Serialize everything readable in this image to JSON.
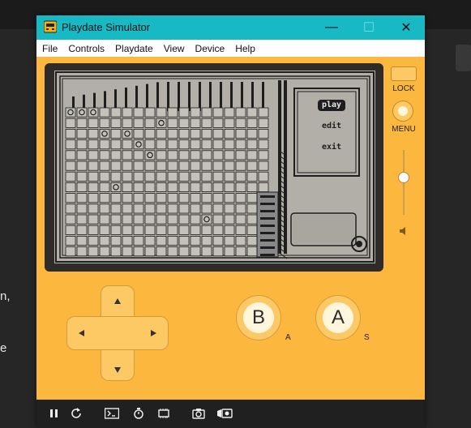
{
  "window": {
    "title": "Playdate Simulator",
    "controls": {
      "minimize": "—",
      "maximize": "☐",
      "close": "✕"
    }
  },
  "menubar": [
    "File",
    "Controls",
    "Playdate",
    "View",
    "Device",
    "Help"
  ],
  "game_menu": {
    "items": [
      "play",
      "edit",
      "exit"
    ],
    "selected": "play"
  },
  "device": {
    "lock_label": "LOCK",
    "menu_label": "MENU",
    "b_label": "B",
    "a_label": "A",
    "b_key_hint": "A",
    "a_key_hint": "S"
  },
  "background": {
    "text_lines": [
      "n,",
      "e"
    ]
  },
  "toolbar": {
    "icons": [
      "pause-icon",
      "restart-icon",
      "console-icon",
      "stopwatch-icon",
      "memory-icon",
      "screenshot-icon",
      "record-video-icon"
    ]
  },
  "colors": {
    "body": "#fbb73e",
    "titlebar": "#16b9c4",
    "screen": "#b2afa8",
    "bezel": "#2f2b28"
  }
}
